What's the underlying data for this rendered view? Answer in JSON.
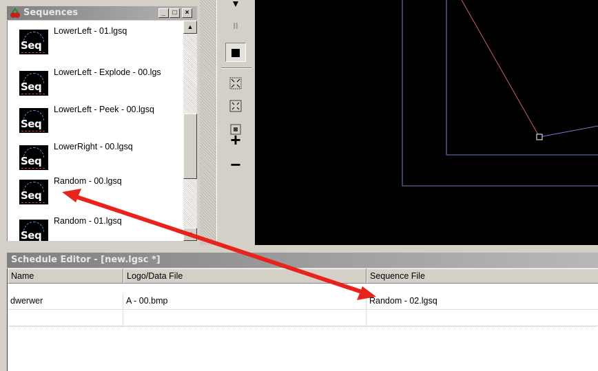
{
  "sequences_panel": {
    "title": "Sequences",
    "window_buttons": [
      "_",
      "□",
      "×"
    ],
    "thumb_label": "Seq",
    "items": [
      {
        "name": "LowerLeft - 01.lgsq"
      },
      {
        "name": "LowerLeft - Explode - 00.lgs"
      },
      {
        "name": "LowerLeft - Peek - 00.lgsq"
      },
      {
        "name": "LowerRight - 00.lgsq"
      },
      {
        "name": "Random - 00.lgsq"
      },
      {
        "name": "Random - 01.lgsq"
      }
    ]
  },
  "toolbar": {
    "pause": "II",
    "zoom_in": "+",
    "zoom_out": "−"
  },
  "schedule_editor": {
    "title": "Schedule Editor - [new.lgsc *]",
    "columns": [
      "Name",
      "Logo/Data File",
      "Sequence File"
    ],
    "rows": [
      [
        "dwerwer",
        "A - 00.bmp",
        "Random - 02.lgsq"
      ]
    ]
  },
  "colors": {
    "annotation_arrow": "#e8231c",
    "canvas_bg": "#000000",
    "guide_line": "#6f7fc0",
    "path_red": "#d06060"
  }
}
